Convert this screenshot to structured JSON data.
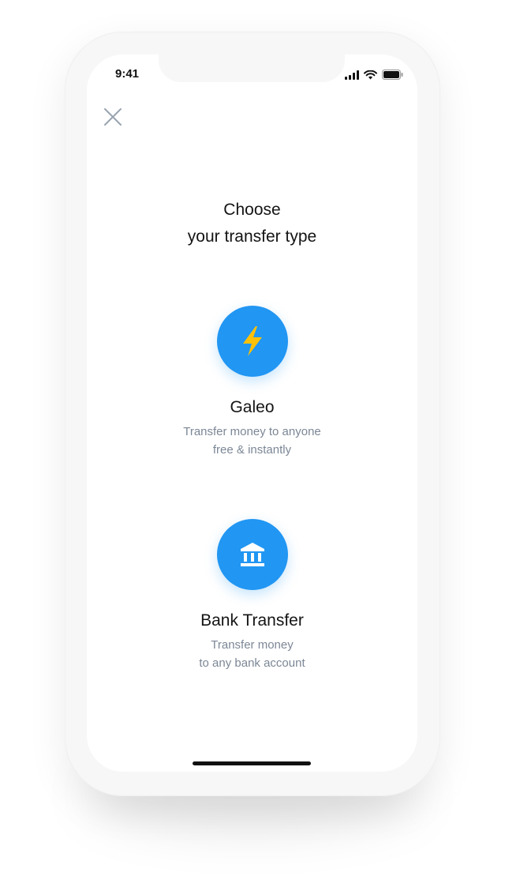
{
  "status_bar": {
    "time": "9:41",
    "icons": [
      "signal-icon",
      "wifi-icon",
      "battery-icon"
    ]
  },
  "header": {
    "close_icon": "close-icon"
  },
  "title": {
    "line1": "Choose",
    "line2": "your transfer type"
  },
  "options": [
    {
      "icon": "lightning-icon",
      "title": "Galeo",
      "desc_line1": "Transfer money to anyone",
      "desc_line2": "free & instantly"
    },
    {
      "icon": "bank-icon",
      "title": "Bank Transfer",
      "desc_line1": "Transfer money",
      "desc_line2": "to any bank account"
    }
  ],
  "colors": {
    "accent": "#2196f3",
    "lightning": "#ffc107",
    "text_primary": "#141414",
    "text_secondary": "#7c8796"
  }
}
